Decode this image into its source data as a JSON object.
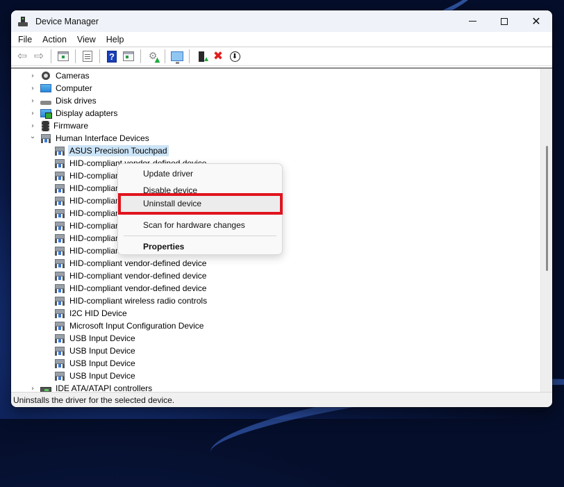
{
  "window": {
    "title": "Device Manager",
    "controls": {
      "minimize": "minimize",
      "maximize": "maximize",
      "close": "close"
    }
  },
  "menubar": [
    "File",
    "Action",
    "View",
    "Help"
  ],
  "toolbar": {
    "buttons": [
      {
        "icon": "back-arrow-icon",
        "tooltip": "Back"
      },
      {
        "icon": "forward-arrow-icon",
        "tooltip": "Forward"
      },
      {
        "icon": "show-hide-console-tree-icon"
      },
      {
        "icon": "properties-icon"
      },
      {
        "icon": "help-icon",
        "glyph": "?"
      },
      {
        "icon": "show-action-pane-icon"
      },
      {
        "icon": "update-driver-icon"
      },
      {
        "icon": "scan-hardware-icon"
      },
      {
        "icon": "enable-device-icon"
      },
      {
        "icon": "uninstall-device-icon",
        "glyph": "✖"
      },
      {
        "icon": "download-icon",
        "glyph": "⬇"
      }
    ]
  },
  "tree": {
    "categories": [
      {
        "label": "Cameras",
        "icon": "camera-icon",
        "expanded": false
      },
      {
        "label": "Computer",
        "icon": "computer-icon",
        "expanded": false
      },
      {
        "label": "Disk drives",
        "icon": "disk-drive-icon",
        "expanded": false
      },
      {
        "label": "Display adapters",
        "icon": "display-adapter-icon",
        "expanded": false
      },
      {
        "label": "Firmware",
        "icon": "firmware-icon",
        "expanded": false
      },
      {
        "label": "Human Interface Devices",
        "icon": "hid-icon",
        "expanded": true
      }
    ],
    "hid_children": [
      {
        "label": "ASUS Precision Touchpad",
        "selected": true
      },
      {
        "label": "HID-compliant vendor-defined device"
      },
      {
        "label": "HID-compliant vendor-defined device"
      },
      {
        "label": "HID-compliant vendor-defined device"
      },
      {
        "label": "HID-compliant vendor-defined device"
      },
      {
        "label": "HID-compliant vendor-defined device"
      },
      {
        "label": "HID-compliant vendor-defined device"
      },
      {
        "label": "HID-compliant vendor-defined device"
      },
      {
        "label": "HID-compliant vendor-defined device"
      },
      {
        "label": "HID-compliant vendor-defined device"
      },
      {
        "label": "HID-compliant vendor-defined device"
      },
      {
        "label": "HID-compliant vendor-defined device"
      },
      {
        "label": "HID-compliant wireless radio controls"
      },
      {
        "label": "I2C HID Device"
      },
      {
        "label": "Microsoft Input Configuration Device"
      },
      {
        "label": "USB Input Device"
      },
      {
        "label": "USB Input Device"
      },
      {
        "label": "USB Input Device"
      },
      {
        "label": "USB Input Device"
      }
    ],
    "after": [
      {
        "label": "IDE ATA/ATAPI controllers",
        "icon": "ide-controller-icon",
        "expanded": false
      }
    ]
  },
  "context_menu": {
    "items": [
      {
        "label": "Update driver"
      },
      {
        "label": "Disable device"
      },
      {
        "label": "Uninstall device",
        "highlighted": true
      },
      {
        "label": "Scan for hardware changes"
      },
      {
        "label": "Properties",
        "bold": true
      }
    ],
    "highlight_color": "#e0141e"
  },
  "statusbar": {
    "text": "Uninstalls the driver for the selected device."
  }
}
